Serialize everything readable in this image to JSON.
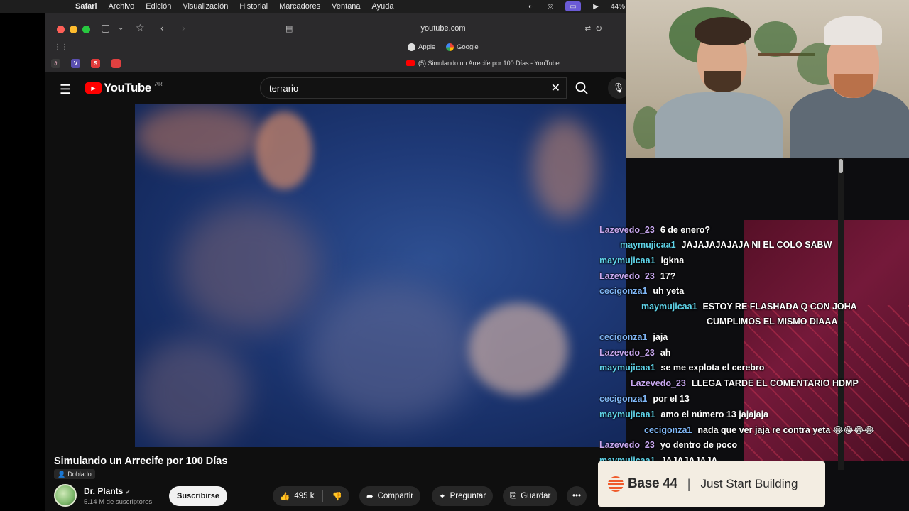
{
  "menubar": {
    "app": "Safari",
    "items": [
      "Archivo",
      "Edición",
      "Visualización",
      "Historial",
      "Marcadores",
      "Ventana",
      "Ayuda"
    ],
    "battery": "44%"
  },
  "safari": {
    "url": "youtube.com",
    "favorites": [
      "Apple",
      "Google"
    ],
    "tab_title": "(5) Simulando un Arrecife por 100 Días - YouTube",
    "extensions": [
      "V",
      "S"
    ]
  },
  "youtube": {
    "logo": "YouTube",
    "country": "AR",
    "search_value": "terrario",
    "video_title": "Simulando un Arrecife por 100 Días",
    "dub_badge": "Doblado",
    "channel_name": "Dr. Plants",
    "subscribers": "5.14 M de suscriptores",
    "subscribe_label": "Suscribirse",
    "likes": "495 k",
    "share_label": "Compartir",
    "ask_label": "Preguntar",
    "save_label": "Guardar"
  },
  "chat": [
    {
      "user": "Lazevedo_23",
      "text": "6 de enero?",
      "color": "purple"
    },
    {
      "user": "maymujicaa1",
      "text": "JAJAJAJAJAJA NI EL COLO SABW",
      "color": "cyan"
    },
    {
      "user": "maymujicaa1",
      "text": "igkna",
      "color": "cyan"
    },
    {
      "user": "Lazevedo_23",
      "text": "17?",
      "color": "purple"
    },
    {
      "user": "cecigonza1",
      "text": "uh yeta",
      "color": "blue"
    },
    {
      "user": "maymujicaa1",
      "text": "ESTOY RE FLASHADA Q CON JOHA",
      "text2": "CUMPLIMOS EL MISMO DIAAA",
      "color": "cyan"
    },
    {
      "user": "cecigonza1",
      "text": "jaja",
      "color": "blue"
    },
    {
      "user": "Lazevedo_23",
      "text": "ah",
      "color": "purple"
    },
    {
      "user": "maymujicaa1",
      "text": "se me explota el cerebro",
      "color": "cyan"
    },
    {
      "user": "Lazevedo_23",
      "text": "LLEGA TARDE EL COMENTARIO HDMP",
      "color": "purple"
    },
    {
      "user": "cecigonza1",
      "text": "por el 13",
      "color": "blue"
    },
    {
      "user": "maymujicaa1",
      "text": "amo el número 13 jajajaja",
      "color": "cyan"
    },
    {
      "user": "cecigonza1",
      "text": "nada que ver jaja re contra yeta 😂😂😂😂",
      "color": "blue"
    },
    {
      "user": "Lazevedo_23",
      "text": "yo dentro de poco",
      "color": "purple"
    },
    {
      "user": "maymujicaa1",
      "text": "JAJAJAJAJA",
      "color": "cyan"
    }
  ],
  "sponsor": {
    "brand": "Base 44",
    "tagline": "Just Start Building"
  }
}
